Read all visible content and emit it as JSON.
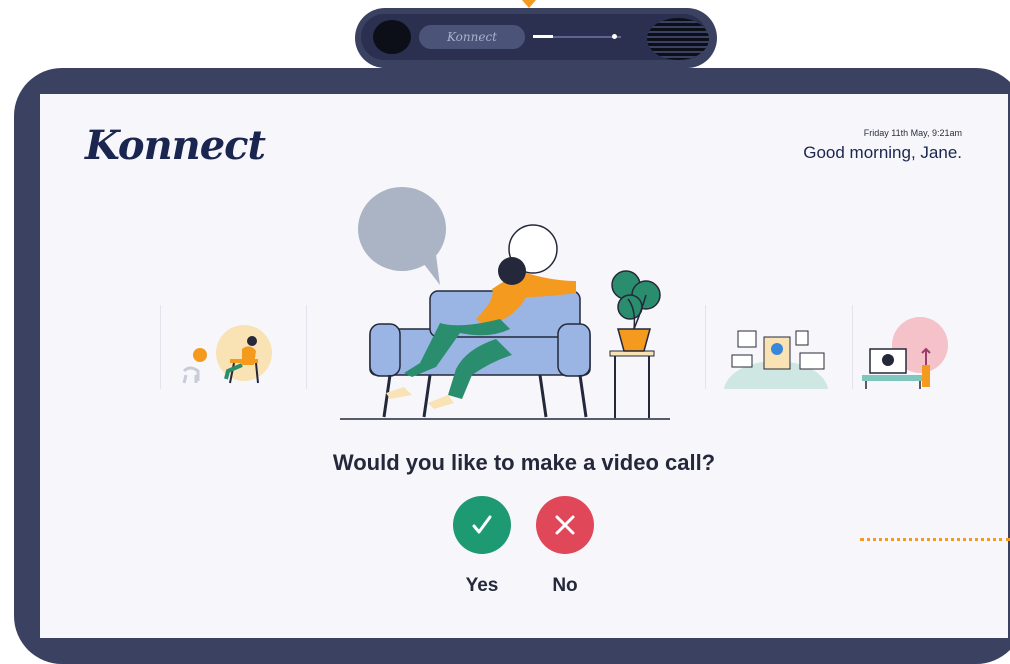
{
  "device": {
    "camera_label": "Konnect"
  },
  "header": {
    "logo": "Konnect",
    "date": "Friday 11th May, 9:21am",
    "greeting": "Good morning, Jane."
  },
  "prompt": {
    "question": "Would you like to make a video call?",
    "yes_label": "Yes",
    "no_label": "No"
  },
  "colors": {
    "frame": "#3b4161",
    "screen": "#f7f7fb",
    "yes": "#1d9a72",
    "no": "#e0485a",
    "accent": "#f39a1f",
    "text": "#24283a"
  },
  "icons": [
    "checkmark-icon",
    "close-icon"
  ]
}
